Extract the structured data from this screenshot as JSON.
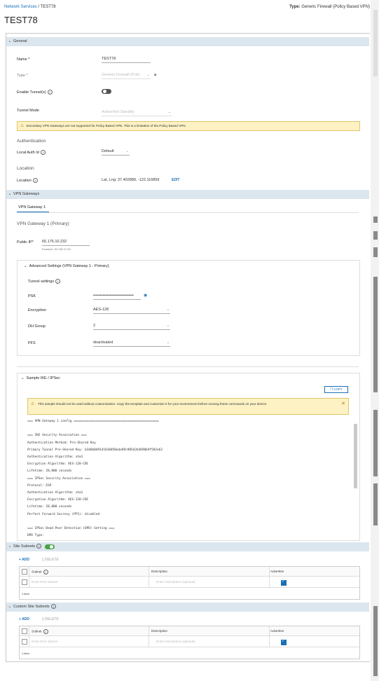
{
  "breadcrumb": {
    "link": "Network Services",
    "separator": " / ",
    "current": "TEST78"
  },
  "header_type": {
    "label": "Type:",
    "value": "Generic Firewall (Policy Based VPN)"
  },
  "title": "TEST78",
  "general": {
    "section_title": "General",
    "name_label": "Name *",
    "name_value": "TEST78",
    "type_label": "Type *",
    "type_value": "Generic Firewall (Polic",
    "enable_tunnels_label": "Enable Tunnel(s)",
    "tunnel_mode_label": "Tunnel Mode",
    "tunnel_mode_value": "Active/Hot Standby",
    "warning": "Secondary VPN Gateways are not supported for Policy Based VPN. This is a limitation of the Policy Based VPN.",
    "auth_heading": "Authentication",
    "local_auth_label": "Local Auth Id",
    "local_auth_value": "Default",
    "location_heading": "Location",
    "location_label": "Location",
    "location_value": "Lat, Lng: 37.402889, -122.116859",
    "edit_label": "EDIT"
  },
  "gateways": {
    "section_title": "VPN Gateways",
    "tab": "VPN Gateway 1",
    "heading": "VPN Gateway 1 (Primary)",
    "public_ip_label": "Public IP*",
    "public_ip_value": "65.175.10.232",
    "public_ip_hint": "Example: 54.182.9.102",
    "advanced_title": "Advanced Settings (VPN Gateway 1 - Primary)",
    "tunnel_settings_label": "Tunnel settings",
    "psk_label": "PSK",
    "psk_value": "••••••••••••••••••••••••••••••",
    "encryption_label": "Encryption",
    "encryption_value": "AES-128",
    "dh_label": "DH Group",
    "dh_value": "2",
    "pfs_label": "PFS",
    "pfs_value": "deactivated"
  },
  "sample": {
    "title": "Sample IKE / IPSec",
    "copy_label": "COPY",
    "warning": "This sample should not be used without customization. Copy the template and customize it for your environment before running these commands on your device.",
    "lines": [
      "=== VPN Gateway 1 config ==============================================",
      "",
      "=== IKE Security Association ===",
      "Authentication Method: Pre-Shared Key",
      "Primary Tunnel Pre-Shared Key: b346b0d9141810858eda99c985d2b4698b9f582e62",
      "Authentication Algorithm: sha1",
      "Encryption Algorithm: AES-128-CBC",
      "Lifetime: 28,800 seconds",
      "=== IPSec Security Association ===",
      "Protocol: ESP",
      "Authentication Algorithm: sha1",
      "Encryption Algorithm: AES-128-CBC",
      "Lifetime: 28,800 seconds",
      "Perfect Forward Secrecy (PFS): disabled",
      "",
      "=== IPSec Dead Peer Detection (DPD) Setting ===",
      "DPD Type:"
    ]
  },
  "site_subnets": {
    "title": "Site Subnets",
    "add": "+ ADD",
    "delete": "DELETE",
    "col_subnet": "Subnet",
    "col_description": "Description",
    "col_advertise": "Advertise",
    "subnet_placeholder": "Enter IPv4 Subnet",
    "description_placeholder": "Enter Description (optional)",
    "footer": "1 item"
  },
  "custom_subnets": {
    "title": "Custom Site Subnets",
    "add": "+ ADD",
    "delete": "DELETE",
    "col_subnet": "Subnet",
    "col_description": "Description",
    "col_advertise": "Advertise",
    "subnet_placeholder": "Enter IPv4 Subnet",
    "description_placeholder": "Enter Description (optional)",
    "footer": "1 item"
  },
  "icons": [
    "info-icon",
    "lock-icon",
    "chevron-down-icon",
    "warning-icon",
    "close-icon",
    "eye-icon",
    "copy-icon",
    "trash-icon"
  ],
  "colors": {
    "accent": "#1a6fb5",
    "section_header": "#dce6ee",
    "warning_bg": "#fdf2c4",
    "toggle_on": "#48a248"
  }
}
